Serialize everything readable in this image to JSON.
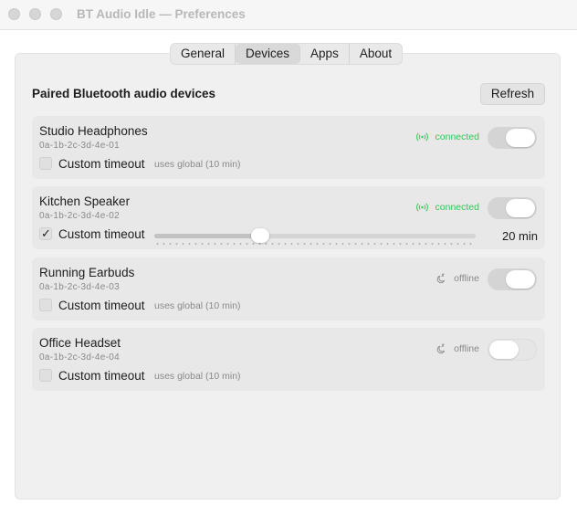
{
  "window": {
    "title": "BT Audio Idle — Preferences"
  },
  "tabs": [
    {
      "label": "General",
      "active": false
    },
    {
      "label": "Devices",
      "active": true
    },
    {
      "label": "Apps",
      "active": false
    },
    {
      "label": "About",
      "active": false
    }
  ],
  "section": {
    "title": "Paired Bluetooth audio devices",
    "refresh_label": "Refresh"
  },
  "colors": {
    "connected": "#34c759",
    "offline": "#8a8a8a",
    "accent": "#d4d4d4"
  },
  "devices": [
    {
      "name": "Studio Headphones",
      "address": "0a-1b-2c-3d-4e-01",
      "status": "connected",
      "status_icon": "signal-waves-icon",
      "enabled": true,
      "custom_timeout": false,
      "checkbox_label": "Custom timeout",
      "timeout_note": "uses global (10 min)"
    },
    {
      "name": "Kitchen Speaker",
      "address": "0a-1b-2c-3d-4e-02",
      "status": "connected",
      "status_icon": "signal-waves-icon",
      "enabled": true,
      "custom_timeout": true,
      "checkbox_label": "Custom timeout",
      "timeout_value": "20 min",
      "timeout_fraction": 0.33
    },
    {
      "name": "Running Earbuds",
      "address": "0a-1b-2c-3d-4e-03",
      "status": "offline",
      "status_icon": "moon-zzz-icon",
      "enabled": true,
      "custom_timeout": false,
      "checkbox_label": "Custom timeout",
      "timeout_note": "uses global (10 min)"
    },
    {
      "name": "Office Headset",
      "address": "0a-1b-2c-3d-4e-04",
      "status": "offline",
      "status_icon": "moon-zzz-icon",
      "enabled": false,
      "custom_timeout": false,
      "checkbox_label": "Custom timeout",
      "timeout_note": "uses global (10 min)"
    }
  ]
}
